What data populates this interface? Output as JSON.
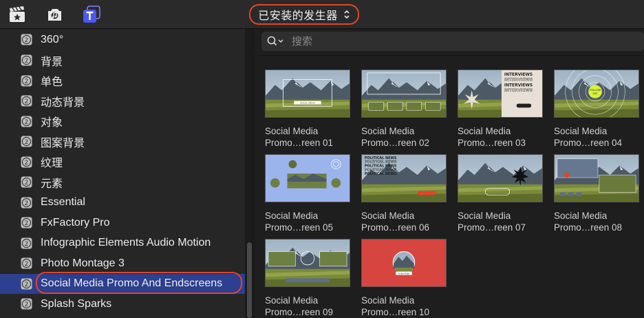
{
  "toolbar": {
    "dropdown_label": "已安装的发生器",
    "icons": [
      "clapper-star-icon",
      "music-camera-icon",
      "title-t-icon"
    ]
  },
  "sidebar": {
    "items": [
      {
        "label": "360°"
      },
      {
        "label": "背景"
      },
      {
        "label": "单色"
      },
      {
        "label": "动态背景"
      },
      {
        "label": "对象"
      },
      {
        "label": "图案背景"
      },
      {
        "label": "纹理"
      },
      {
        "label": "元素"
      },
      {
        "label": "Essential"
      },
      {
        "label": "FxFactory Pro"
      },
      {
        "label": "Infographic Elements Audio Motion"
      },
      {
        "label": "Photo Montage 3"
      },
      {
        "label": "Social Media Promo And Endscreens",
        "selected": true
      },
      {
        "label": "Splash Sparks"
      }
    ]
  },
  "search": {
    "placeholder": "搜索"
  },
  "tiles": [
    {
      "line1": "Social Media",
      "line2": "Promo…reen 01"
    },
    {
      "line1": "Social Media",
      "line2": "Promo…reen 02"
    },
    {
      "line1": "Social Media",
      "line2": "Promo…reen 03"
    },
    {
      "line1": "Social Media",
      "line2": "Promo…reen 04"
    },
    {
      "line1": "Social Media",
      "line2": "Promo…reen 05"
    },
    {
      "line1": "Social Media",
      "line2": "Promo…reen 06"
    },
    {
      "line1": "Social Media",
      "line2": "Promo…reen 07"
    },
    {
      "line1": "Social Media",
      "line2": "Promo…reen 08"
    },
    {
      "line1": "Social Media",
      "line2": "Promo…reen 09"
    },
    {
      "line1": "Social Media",
      "line2": "Promo…reen 10"
    }
  ],
  "colors": {
    "highlight": "#e2452b",
    "selection": "#2d3f8f",
    "red_tile": "#d6453f"
  }
}
